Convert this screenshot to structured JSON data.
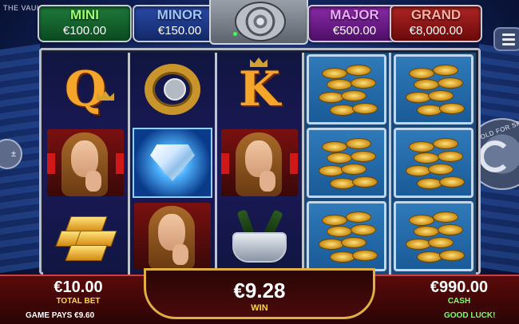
{
  "game": {
    "title": "THE VAULT"
  },
  "jackpots": {
    "mini": {
      "name": "MINI",
      "amount": "€100.00"
    },
    "minor": {
      "name": "MINOR",
      "amount": "€150.00"
    },
    "major": {
      "name": "MAJOR",
      "amount": "€500.00"
    },
    "grand": {
      "name": "GRAND",
      "amount": "€8,000.00"
    }
  },
  "controls": {
    "hold_for_spin": "HOLD FOR SPIN",
    "bet_adjust_icon": "plus-minus-icon",
    "menu_icon": "hamburger-icon"
  },
  "reels": [
    [
      "Q",
      "woman",
      "gold-bars"
    ],
    [
      "ring",
      "diamond",
      "woman"
    ],
    [
      "K",
      "woman",
      "champagne-bucket"
    ],
    [
      "coins",
      "coins",
      "coins"
    ],
    [
      "coins",
      "coins",
      "coins"
    ]
  ],
  "bottom": {
    "total_bet_value": "€10.00",
    "total_bet_label": "TOTAL BET",
    "win_value": "€9.28",
    "win_label": "WIN",
    "cash_value": "€990.00",
    "cash_label": "CASH",
    "game_pays": "GAME PAYS €9.60",
    "message": "GOOD LUCK!"
  },
  "colors": {
    "mini": "#1f7a3a",
    "minor": "#2a4aa8",
    "major": "#8a2aa8",
    "grand": "#b02424",
    "label_yellow": "#ffd640",
    "label_green": "#7cff6a"
  }
}
